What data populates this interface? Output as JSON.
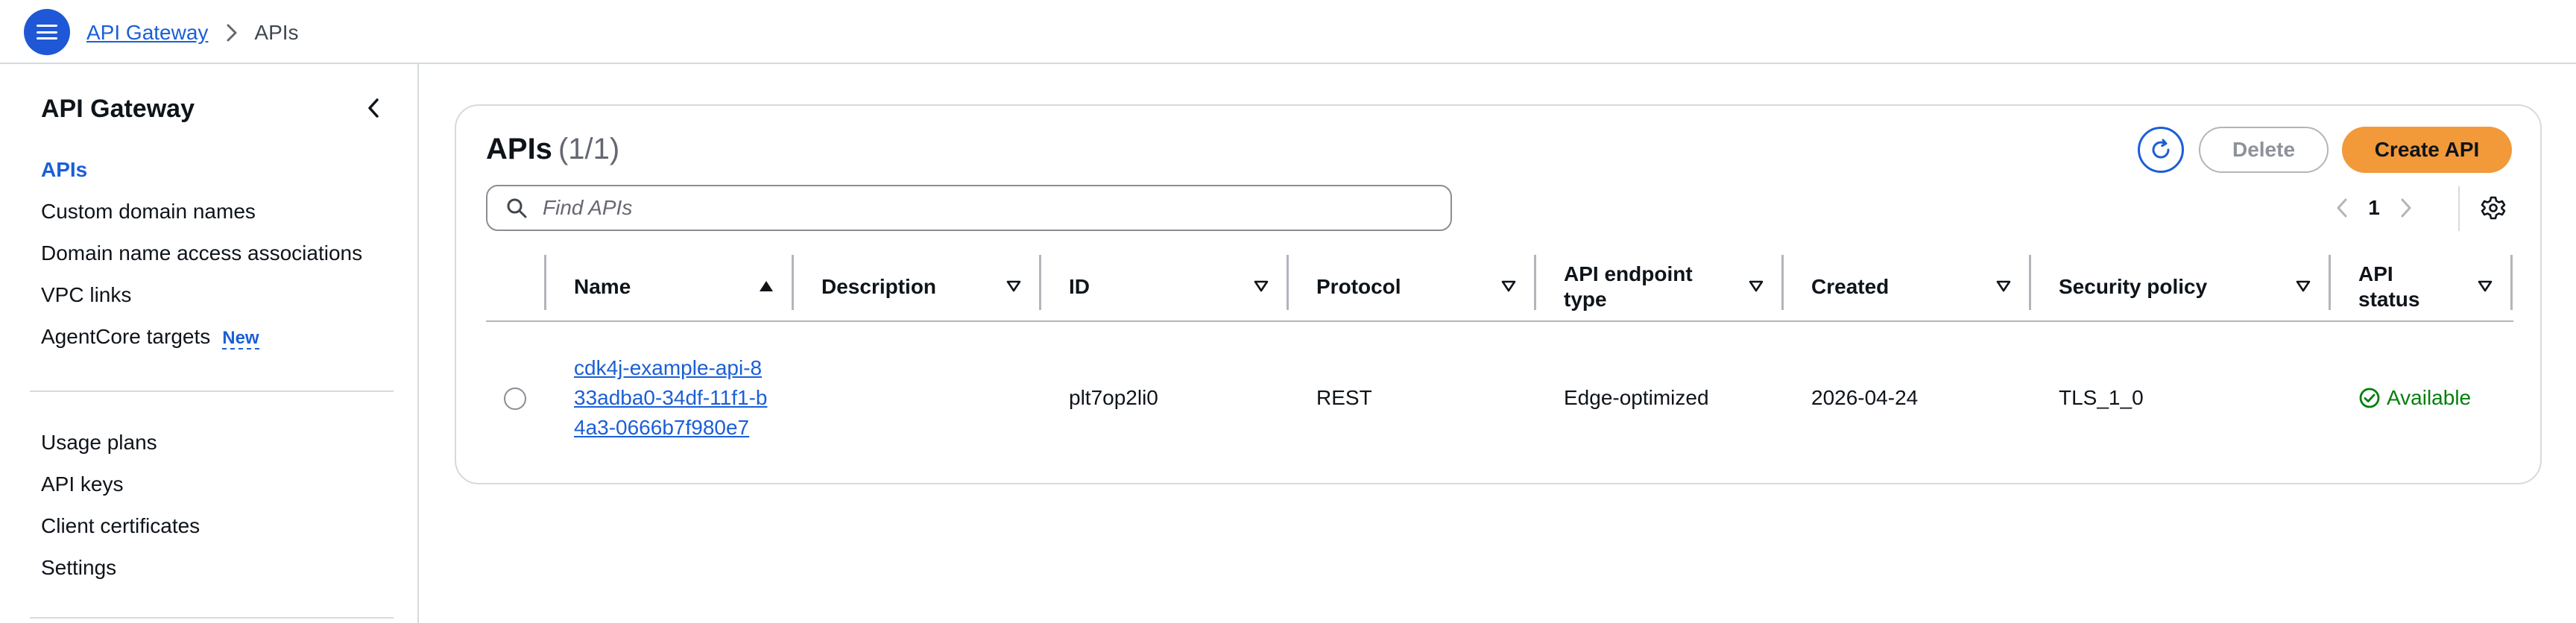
{
  "topbar": {
    "breadcrumb": [
      {
        "label": "API Gateway"
      },
      {
        "label": "APIs"
      }
    ]
  },
  "sidebar": {
    "title": "API Gateway",
    "group1": [
      {
        "label": "APIs",
        "active": true
      },
      {
        "label": "Custom domain names"
      },
      {
        "label": "Domain name access associations"
      },
      {
        "label": "VPC links"
      },
      {
        "label": "AgentCore targets",
        "badge": "New"
      }
    ],
    "group2": [
      {
        "label": "Usage plans"
      },
      {
        "label": "API keys"
      },
      {
        "label": "Client certificates"
      },
      {
        "label": "Settings"
      }
    ]
  },
  "main": {
    "title": "APIs",
    "count": "(1/1)",
    "buttons": {
      "delete": "Delete",
      "create": "Create API"
    },
    "search": {
      "placeholder": "Find APIs",
      "value": ""
    },
    "pagination": {
      "current_page": "1"
    },
    "table": {
      "columns": [
        {
          "label": "Name",
          "sort": "ascending"
        },
        {
          "label": "Description",
          "sort": "none"
        },
        {
          "label": "ID",
          "sort": "none"
        },
        {
          "label": "Protocol",
          "sort": "none"
        },
        {
          "label": "API endpoint type",
          "sort": "none"
        },
        {
          "label": "Created",
          "sort": "none"
        },
        {
          "label": "Security policy",
          "sort": "none"
        },
        {
          "label": "API status",
          "sort": "none"
        }
      ],
      "rows": [
        {
          "selected": false,
          "name": "cdk4j-example-api-833adba0-34df-11f1-b4a3-0666b7f980e7",
          "description": "",
          "id": "plt7op2li0",
          "protocol": "REST",
          "endpoint_type": "Edge-optimized",
          "created": "2026-04-24",
          "security_policy": "TLS_1_0",
          "status": "Available"
        }
      ]
    }
  },
  "colors": {
    "accent_blue": "#1b5fd6",
    "primary_button": "#f2993a",
    "status_success": "#037f0c",
    "border": "#d5dbdb"
  }
}
